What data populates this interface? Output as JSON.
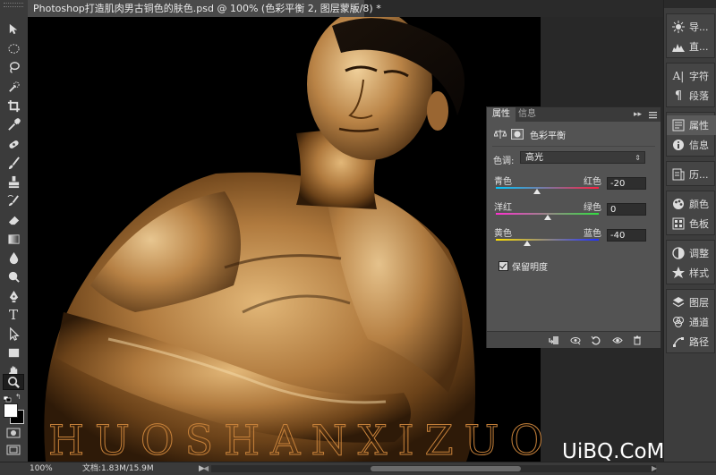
{
  "document": {
    "tab_title": "Photoshop打造肌肉男古铜色的肤色.psd @ 100% (色彩平衡 2, 图层蒙版/8) *",
    "close_glyph": "×"
  },
  "watermark": {
    "text": "HUOSHANXIZUO",
    "logo": "UiBQ.CoM"
  },
  "tools": [
    "move-tool",
    "marquee-tool",
    "lasso-tool",
    "quick-select-tool",
    "crop-tool",
    "eyedropper-tool",
    "healing-brush-tool",
    "brush-tool",
    "clone-stamp-tool",
    "history-brush-tool",
    "eraser-tool",
    "gradient-tool",
    "blur-tool",
    "dodge-tool",
    "pen-tool",
    "type-tool",
    "path-select-tool",
    "shape-tool",
    "hand-tool",
    "zoom-tool"
  ],
  "type_tool_glyph": "T",
  "dock": {
    "items": [
      {
        "label": "导...",
        "icon": "navigator-icon"
      },
      {
        "label": "直...",
        "icon": "histogram-icon"
      },
      {
        "label": "字符",
        "icon": "character-icon"
      },
      {
        "label": "段落",
        "icon": "paragraph-icon"
      },
      {
        "label": "属性",
        "icon": "properties-icon"
      },
      {
        "label": "信息",
        "icon": "info-icon"
      },
      {
        "label": "历...",
        "icon": "history-icon"
      },
      {
        "label": "颜色",
        "icon": "color-icon"
      },
      {
        "label": "色板",
        "icon": "swatches-icon"
      },
      {
        "label": "调整",
        "icon": "adjustments-icon"
      },
      {
        "label": "样式",
        "icon": "styles-icon"
      },
      {
        "label": "图层",
        "icon": "layers-icon"
      },
      {
        "label": "通道",
        "icon": "channels-icon"
      },
      {
        "label": "路径",
        "icon": "paths-icon"
      }
    ]
  },
  "properties": {
    "tab_active": "属性",
    "tab_inactive": "信息",
    "collapse_glyph": "▸▸",
    "type_label": "色彩平衡",
    "tone_label": "色调:",
    "tone_value": "高光",
    "sliders": [
      {
        "left": "青色",
        "right": "红色",
        "value": "-20",
        "level": -20
      },
      {
        "left": "洋红",
        "right": "绿色",
        "value": "0",
        "level": 0
      },
      {
        "left": "黄色",
        "right": "蓝色",
        "value": "-40",
        "level": -40
      }
    ],
    "preserve_label": "保留明度",
    "preserve_checked": true
  },
  "status": {
    "zoom": "100%",
    "doc_info": "文档:1.83M/15.9M",
    "arrow": "▶"
  },
  "colors": {
    "canvas_bg": "#282828",
    "panel_bg": "#535353"
  }
}
